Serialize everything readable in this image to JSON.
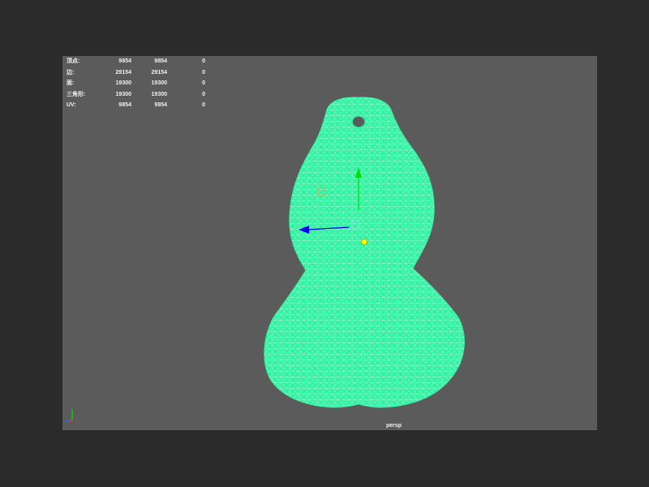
{
  "viewport": {
    "camera_label": "persp",
    "background": "#5b5b5b",
    "mesh_color": "#2ff1a0",
    "wire_color": "#b9ffe0"
  },
  "heads_up": {
    "rows": [
      {
        "label": "顶点:",
        "v1": "9854",
        "v2": "9854",
        "v3": "0"
      },
      {
        "label": "边:",
        "v1": "29154",
        "v2": "29154",
        "v3": "0"
      },
      {
        "label": "面:",
        "v1": "19300",
        "v2": "19300",
        "v3": "0"
      },
      {
        "label": "三角形:",
        "v1": "19300",
        "v2": "19300",
        "v3": "0"
      },
      {
        "label": "UV:",
        "v1": "9854",
        "v2": "9854",
        "v3": "0"
      }
    ]
  },
  "manipulator": {
    "y_axis_color": "#00e000",
    "x_axis_color": "#0000ff",
    "pivot_color": "#ffff00"
  }
}
